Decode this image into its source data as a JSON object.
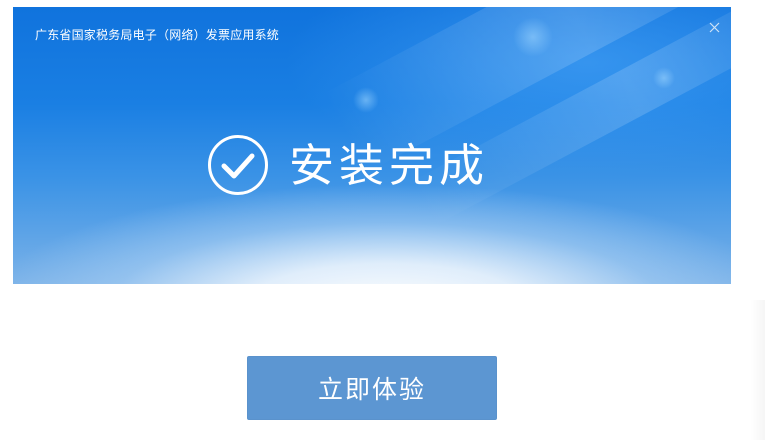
{
  "window": {
    "title": "广东省国家税务局电子（网络）发票应用系统",
    "close_icon": "close-icon"
  },
  "status": {
    "icon": "check-circle-icon",
    "text": "安装完成"
  },
  "actions": {
    "primary_label": "立即体验"
  },
  "colors": {
    "banner_top": "#1073dd",
    "banner_bottom": "#7bb2e8",
    "button": "#5c96d2",
    "text_on_blue": "#ffffff"
  }
}
